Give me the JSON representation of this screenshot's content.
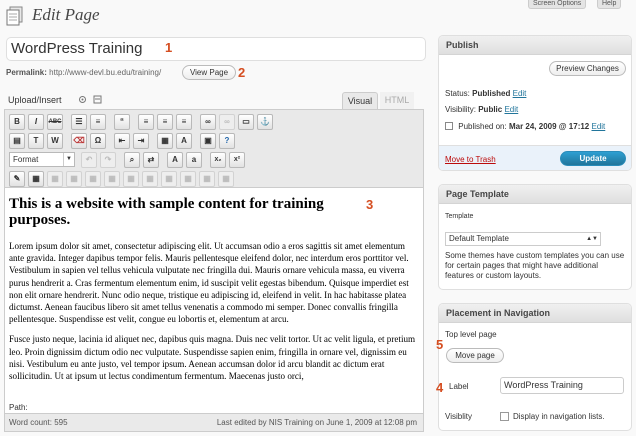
{
  "header": {
    "title": "Edit Page",
    "screen_options": "Screen Options",
    "help": "Help"
  },
  "post": {
    "title": "WordPress Training",
    "permalink_label": "Permalink:",
    "permalink_url": "http://www-devl.bu.edu/training/",
    "view_page": "View Page"
  },
  "annotations": [
    "1",
    "2",
    "3",
    "4",
    "5"
  ],
  "editor": {
    "upload_insert": "Upload/Insert",
    "tab_visual": "Visual",
    "tab_html": "HTML",
    "format": "Format",
    "heading": "This is a website with sample content for training purposes.",
    "paragraph1": "Lorem ipsum dolor sit amet, consectetur adipiscing elit. Ut accumsan odio a eros sagittis sit amet elementum ante gravida. Integer dapibus tempor felis. Mauris pellentesque eleifend dolor, nec interdum eros porttitor vel. Vestibulum in sapien vel tellus vehicula vulputate nec fringilla dui. Mauris ornare vehicula massa, eu viverra purus hendrerit a. Cras fermentum elementum enim, id suscipit velit egestas bibendum. Quisque imperdiet est non elit ornare hendrerit. Nunc odio neque, tristique eu adipiscing id, eleifend in velit. In hac habitasse platea dictumst. Aenean faucibus libero sit amet tellus venenatis a commodo mi semper. Donec convallis fringilla pellentesque. Suspendisse est velit, congue eu lobortis et, elementum at arcu.",
    "paragraph2": "Fusce justo neque, lacinia id aliquet nec, dapibus quis magna. Duis nec velit tortor. Ut ac velit ligula, et pretium leo. Proin dignissim dictum odio nec vulputate. Suspendisse sapien enim, fringilla in ornare vel, dignissim eu nisi. Vestibulum eu ante justo, vel tempor ipsum. Aenean accumsan dolor id arcu blandit ac dictum erat sollicitudin. Ut at ipsum ut lectus condimentum fermentum. Maecenas justo orci,",
    "path": "Path:",
    "word_count": "Word count: 595",
    "last_edited": "Last edited by NIS Training on June 1, 2009 at 12:08 pm"
  },
  "publish": {
    "title": "Publish",
    "preview": "Preview Changes",
    "status_label": "Status:",
    "status_value": "Published",
    "visibility_label": "Visibility:",
    "visibility_value": "Public",
    "published_label": "Published on:",
    "published_value": "Mar 24, 2009 @ 17:12",
    "edit": "Edit",
    "trash": "Move to Trash",
    "update": "Update"
  },
  "page_template": {
    "title": "Page Template",
    "label": "Template",
    "selected": "Default Template",
    "help": "Some themes have custom templates you can use for certain pages that might have additional features or custom layouts."
  },
  "navigation": {
    "title": "Placement in Navigation",
    "top_level": "Top level page",
    "move_page": "Move page",
    "label_label": "Label",
    "label_value": "WordPress Training",
    "visibility_label": "Visiblity",
    "display_label": "Display in navigation lists."
  }
}
